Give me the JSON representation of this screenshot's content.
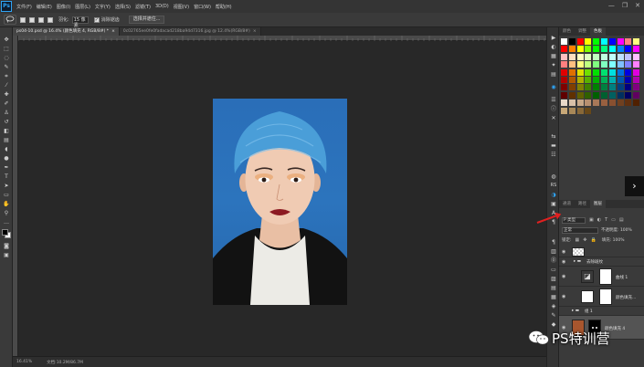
{
  "app": {
    "logo": "Ps",
    "menus": [
      "文件(F)",
      "编辑(E)",
      "图像(I)",
      "图层(L)",
      "文字(Y)",
      "选择(S)",
      "滤镜(T)",
      "3D(D)",
      "视图(V)",
      "窗口(W)",
      "帮助(H)"
    ],
    "window_controls": [
      "—",
      "❐",
      "✕"
    ]
  },
  "options": {
    "feather_label": "羽化:",
    "feather_value": "15 像素",
    "antialias_label": "消除锯齿",
    "select_mask_label": "选择并遮住..."
  },
  "tabs": [
    {
      "label": "ps04-10.psd @ 16.4% (颜色填充 4, RGB/8#) *",
      "active": true
    },
    {
      "label": "0c02765ee0fe0fadacad218ba94d7316.jpg @ 12.4%(RGB/8#)",
      "active": false
    }
  ],
  "status": {
    "zoom": "16.41%",
    "doc": "文档:10.2M/86.7M"
  },
  "panels": {
    "top_tabs": [
      "颜色",
      "调整",
      "色板"
    ],
    "layer_tabs": [
      "通道",
      "路径",
      "图层"
    ],
    "kind_label": "P 类型",
    "blend_mode": "正常",
    "opacity": "不透明度: 100%",
    "lock_label": "锁定:",
    "fill": "填充: 100%"
  },
  "layers": [
    {
      "name": "",
      "visible": true
    },
    {
      "name": "去除斑纹",
      "visible": true
    },
    {
      "name": "曲线 1",
      "visible": true
    },
    {
      "name": "颜色填充...",
      "visible": true
    },
    {
      "name": "组 1",
      "visible": false
    },
    {
      "name": "颜色填充 4",
      "visible": true,
      "selected": true
    }
  ],
  "watermark": {
    "text": "PS特训营"
  },
  "colors": {
    "ps_blue": "#2fa4f5",
    "canvas": "#282828",
    "photo_bg": "#2a6eb8",
    "arrow": "#e02020"
  },
  "icons": [
    "marquee-icon",
    "lasso-icon",
    "crop-icon",
    "eyedropper-icon",
    "brush-icon",
    "eraser-icon",
    "text-icon",
    "hand-icon",
    "zoom-icon",
    "eye-icon",
    "lock-icon",
    "chevron-right-icon",
    "wechat-icon"
  ]
}
